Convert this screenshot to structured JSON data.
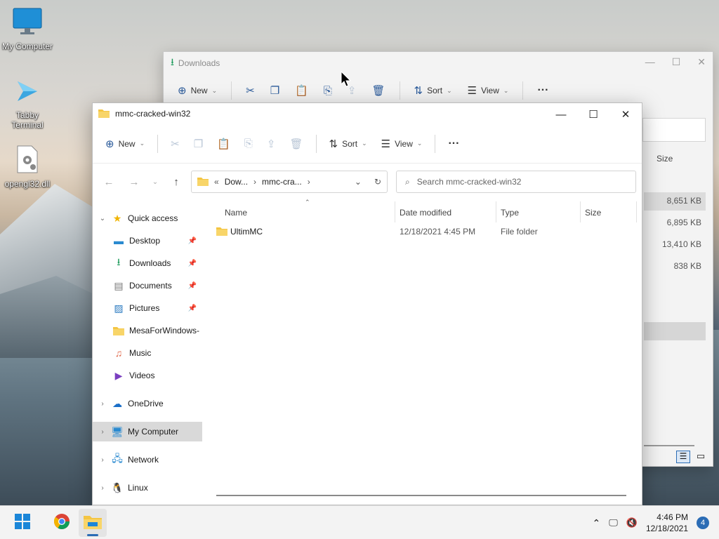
{
  "desktop": {
    "icons": [
      {
        "label": "My Computer",
        "icon": "monitor-icon"
      },
      {
        "label": "Tabby Terminal",
        "icon": "tabby-terminal-icon"
      },
      {
        "label": "opengl32.dll",
        "icon": "dll-settings-file-icon"
      }
    ]
  },
  "back_window": {
    "title": "Downloads",
    "toolbar": {
      "new": "New",
      "sort": "Sort",
      "view": "View"
    },
    "size_header": "Size",
    "sizes": [
      "8,651 KB",
      "6,895 KB",
      "13,410 KB",
      "838 KB"
    ]
  },
  "front_window": {
    "title": "mmc-cracked-win32",
    "toolbar": {
      "new": "New",
      "sort": "Sort",
      "view": "View",
      "more": "···"
    },
    "address": {
      "overflow": "«",
      "crumb1": "Dow...",
      "crumb2": "mmc-cra...",
      "sep": "›"
    },
    "search_placeholder": "Search mmc-cracked-win32",
    "nav": {
      "quick_access": "Quick access",
      "items": [
        {
          "label": "Desktop",
          "pinned": true
        },
        {
          "label": "Downloads",
          "pinned": true
        },
        {
          "label": "Documents",
          "pinned": true
        },
        {
          "label": "Pictures",
          "pinned": true
        },
        {
          "label": "MesaForWindows-",
          "pinned": false
        },
        {
          "label": "Music",
          "pinned": false
        },
        {
          "label": "Videos",
          "pinned": false
        }
      ],
      "onedrive": "OneDrive",
      "my_computer": "My Computer",
      "network": "Network",
      "linux": "Linux"
    },
    "columns": {
      "name": "Name",
      "date": "Date modified",
      "type": "Type",
      "size": "Size"
    },
    "files": [
      {
        "name": "UltimMC",
        "date": "12/18/2021 4:45 PM",
        "type": "File folder",
        "size": ""
      }
    ]
  },
  "taskbar": {
    "time": "4:46 PM",
    "date": "12/18/2021",
    "notification_count": "4"
  },
  "colors": {
    "accent": "#2b6cb5",
    "folder": "#f4c542",
    "selected": "#d9d9d9"
  }
}
